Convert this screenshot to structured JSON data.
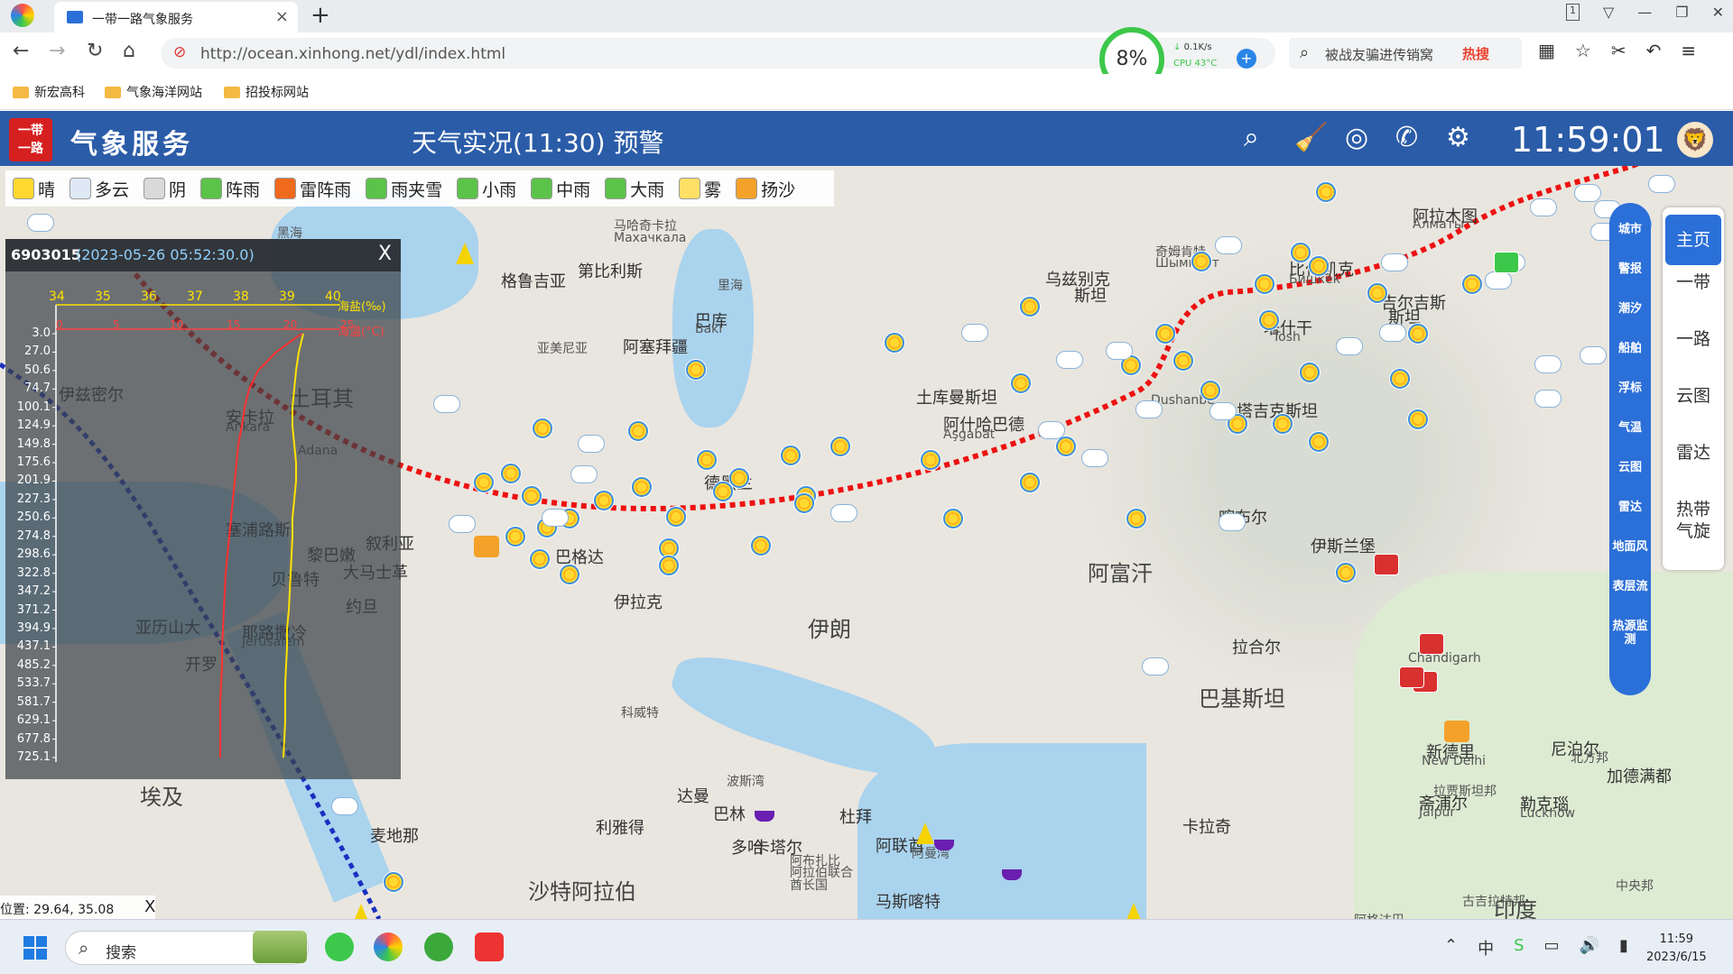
{
  "browser": {
    "tab_title": "一带一路气象服务",
    "tab_close": "×",
    "new_tab": "+",
    "url": "http://ocean.xinhong.net/ydl/index.html",
    "cpu_percent": "8%",
    "cpu_net": "0.1K/s",
    "cpu_temp": "CPU 43°C",
    "search_text": "被战友骗进传销窝",
    "hot_label": "热搜",
    "bookmarks": [
      "新宏高科",
      "气象海洋网站",
      "招投标网站"
    ],
    "win_controls": [
      "1",
      "▽",
      "—",
      "❐",
      "✕"
    ]
  },
  "app": {
    "logo_text": "一带\n一路",
    "title": "气象服务",
    "subtitle": "天气实况(11:30) 预警",
    "clock": "11:59:01"
  },
  "legend": [
    {
      "label": "晴",
      "color": "#ffd830"
    },
    {
      "label": "多云",
      "color": "#dfe9f5"
    },
    {
      "label": "阴",
      "color": "#d9d9d9"
    },
    {
      "label": "阵雨",
      "color": "#5bc24a"
    },
    {
      "label": "雷阵雨",
      "color": "#f06a1e"
    },
    {
      "label": "雨夹雪",
      "color": "#5bc24a"
    },
    {
      "label": "小雨",
      "color": "#5bc24a"
    },
    {
      "label": "中雨",
      "color": "#5bc24a"
    },
    {
      "label": "大雨",
      "color": "#5bc24a"
    },
    {
      "label": "雾",
      "color": "#ffe066"
    },
    {
      "label": "扬沙",
      "color": "#f4a12a"
    }
  ],
  "popup": {
    "station_id": "6903015",
    "datetime": "(2023-05-26 05:52:30.0)",
    "close": "X",
    "salinity_label": "海盐(‰)",
    "temp_label": "海温(°C)",
    "salinity_ticks": [
      "34",
      "35",
      "36",
      "37",
      "38",
      "39",
      "40"
    ],
    "temp_ticks": [
      "0",
      "5",
      "10",
      "15",
      "20",
      "25"
    ],
    "depths": [
      "3.0",
      "27.0",
      "50.6",
      "74.7",
      "100.1",
      "124.9",
      "149.8",
      "175.6",
      "201.9",
      "227.3",
      "250.6",
      "274.8",
      "298.6",
      "322.8",
      "347.2",
      "371.2",
      "394.9",
      "437.1",
      "485.2",
      "533.7",
      "581.7",
      "629.1",
      "677.8",
      "725.1"
    ]
  },
  "map": {
    "labels": [
      {
        "t": "黑海",
        "c": "sm"
      },
      {
        "t": "马哈奇卡拉",
        "c": "sm"
      },
      {
        "t": "Махачкала",
        "c": "sm"
      },
      {
        "t": "格鲁吉亚",
        "c": ""
      },
      {
        "t": "第比利斯",
        "c": ""
      },
      {
        "t": "里海",
        "c": "sm"
      },
      {
        "t": "巴库",
        "c": ""
      },
      {
        "t": "Bakı",
        "c": "sm"
      },
      {
        "t": "亚美尼亚",
        "c": "sm"
      },
      {
        "t": "阿塞拜疆",
        "c": ""
      },
      {
        "t": "乌兹别克",
        "c": ""
      },
      {
        "t": "斯坦",
        "c": ""
      },
      {
        "t": "奇姆肯特",
        "c": "sm"
      },
      {
        "t": "Шымкент",
        "c": "sm"
      },
      {
        "t": "比什凯克",
        "c": ""
      },
      {
        "t": "Бишкек",
        "c": "sm"
      },
      {
        "t": "阿拉木图",
        "c": ""
      },
      {
        "t": "Алматы",
        "c": "sm"
      },
      {
        "t": "吉尔吉斯",
        "c": ""
      },
      {
        "t": "斯坦",
        "c": ""
      },
      {
        "t": "塔什干",
        "c": ""
      },
      {
        "t": "Tosh",
        "c": "sm"
      },
      {
        "t": "土库曼斯坦",
        "c": ""
      },
      {
        "t": "阿什哈巴德",
        "c": ""
      },
      {
        "t": "Aşgabat",
        "c": "sm"
      },
      {
        "t": "Dushanbe",
        "c": "sm"
      },
      {
        "t": "塔吉克斯坦",
        "c": ""
      },
      {
        "t": "喀布尔",
        "c": ""
      },
      {
        "t": "阿富汗",
        "c": "big"
      },
      {
        "t": "伊斯兰堡",
        "c": ""
      },
      {
        "t": "伊朗",
        "c": "big"
      },
      {
        "t": "德黑兰",
        "c": ""
      },
      {
        "t": "巴格达",
        "c": ""
      },
      {
        "t": "伊拉克",
        "c": ""
      },
      {
        "t": "叙利亚",
        "c": ""
      },
      {
        "t": "土耳其",
        "c": "big"
      },
      {
        "t": "安卡拉",
        "c": ""
      },
      {
        "t": "Ankara",
        "c": "sm"
      },
      {
        "t": "伊兹密尔",
        "c": ""
      },
      {
        "t": "Adana",
        "c": "sm"
      },
      {
        "t": "塞浦路斯",
        "c": ""
      },
      {
        "t": "黎巴嫩",
        "c": ""
      },
      {
        "t": "大马士革",
        "c": ""
      },
      {
        "t": "贝鲁特",
        "c": ""
      },
      {
        "t": "耶路撒冷",
        "c": ""
      },
      {
        "t": "Jerusalem",
        "c": "sm"
      },
      {
        "t": "约旦",
        "c": ""
      },
      {
        "t": "亚历山大",
        "c": ""
      },
      {
        "t": "开罗",
        "c": ""
      },
      {
        "t": "埃及",
        "c": "big"
      },
      {
        "t": "科威特",
        "c": "sm"
      },
      {
        "t": "巴基斯坦",
        "c": "big"
      },
      {
        "t": "拉合尔",
        "c": ""
      },
      {
        "t": "Chandigarh",
        "c": "sm"
      },
      {
        "t": "新德里",
        "c": ""
      },
      {
        "t": "New Delhi",
        "c": "sm"
      },
      {
        "t": "尼泊尔",
        "c": ""
      },
      {
        "t": "加德满都",
        "c": ""
      },
      {
        "t": "北方邦",
        "c": "sm"
      },
      {
        "t": "拉贾斯坦邦",
        "c": "sm"
      },
      {
        "t": "斋浦尔",
        "c": ""
      },
      {
        "t": "Jaipur",
        "c": "sm"
      },
      {
        "t": "勒克瑙",
        "c": ""
      },
      {
        "t": "Lucknow",
        "c": "sm"
      },
      {
        "t": "卡拉奇",
        "c": ""
      },
      {
        "t": "达曼",
        "c": ""
      },
      {
        "t": "巴林",
        "c": ""
      },
      {
        "t": "多哈",
        "c": ""
      },
      {
        "t": "卡塔尔",
        "c": ""
      },
      {
        "t": "杜拜",
        "c": ""
      },
      {
        "t": "阿联酋",
        "c": ""
      },
      {
        "t": "阿布扎比",
        "c": "sm"
      },
      {
        "t": "阿拉伯联合",
        "c": "sm"
      },
      {
        "t": "酋长国",
        "c": "sm"
      },
      {
        "t": "马斯喀特",
        "c": ""
      },
      {
        "t": "利雅得",
        "c": ""
      },
      {
        "t": "麦地那",
        "c": ""
      },
      {
        "t": "沙特阿拉伯",
        "c": "big"
      },
      {
        "t": "波斯湾",
        "c": "sm"
      },
      {
        "t": "阿曼湾",
        "c": "sm"
      },
      {
        "t": "印度",
        "c": "big"
      },
      {
        "t": "中央邦",
        "c": "sm"
      },
      {
        "t": "古吉拉特邦",
        "c": "sm"
      },
      {
        "t": "阿格达巴",
        "c": "sm"
      }
    ]
  },
  "side_tools": [
    "城市",
    "警报",
    "潮汐",
    "船舶",
    "浮标",
    "气温",
    "云图",
    "雷达",
    "地面风",
    "表层流",
    "热源监测"
  ],
  "right_panel": [
    "主页",
    "一带",
    "一路",
    "云图",
    "雷达",
    "热带\n气旋"
  ],
  "position": {
    "label": "位置: 29.64, 35.08",
    "close": "X"
  },
  "taskbar": {
    "search_placeholder": "搜索",
    "time": "11:59",
    "date": "2023/6/15"
  }
}
